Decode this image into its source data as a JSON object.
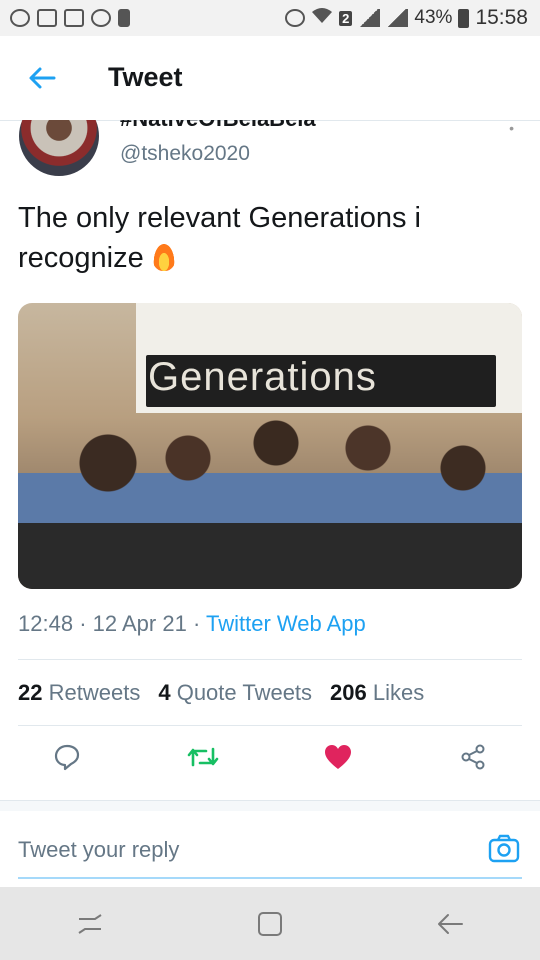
{
  "status_bar": {
    "sim_label": "2",
    "battery": "43%",
    "time": "15:58"
  },
  "header": {
    "title": "Tweet"
  },
  "author": {
    "display_name": "#NativeOfBelaBela",
    "handle": "@tsheko2020"
  },
  "tweet": {
    "text": "The only relevant Generations i recognize",
    "image_banner_text": "Generations",
    "time": "12:48",
    "date": "12 Apr 21",
    "app": "Twitter Web App"
  },
  "stats": {
    "retweets_count": "22",
    "retweets_label": "Retweets",
    "quotes_count": "4",
    "quotes_label": "Quote Tweets",
    "likes_count": "206",
    "likes_label": "Likes"
  },
  "reply": {
    "placeholder": "Tweet your reply"
  },
  "colors": {
    "accent": "#1da1f2",
    "retweet": "#17bf63",
    "like": "#e0245e",
    "muted": "#657786"
  },
  "icons": {
    "back": "arrow-left-icon",
    "reply": "speech-bubble-icon",
    "retweet": "retweet-icon",
    "like": "heart-icon",
    "share": "share-icon",
    "camera": "camera-icon"
  }
}
